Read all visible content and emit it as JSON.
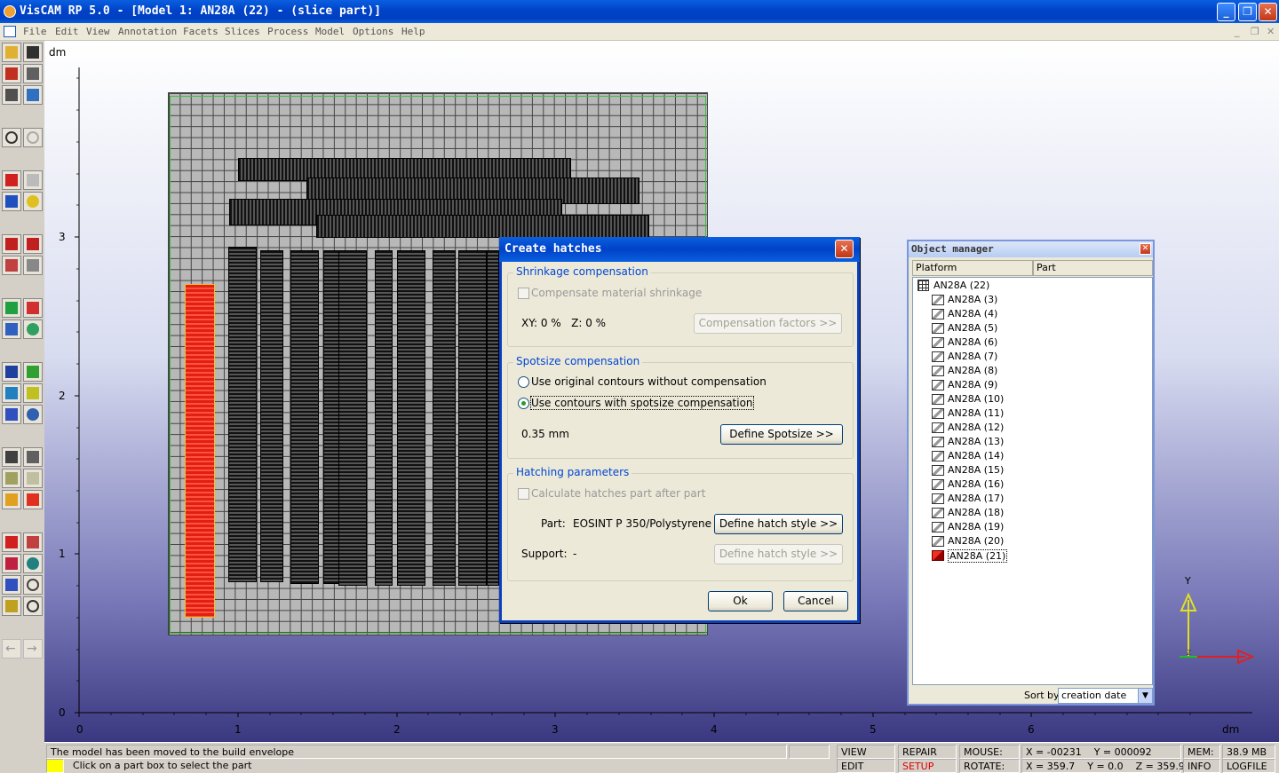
{
  "window": {
    "title": "VisCAM RP 5.0 - [Model 1: AN28A (22) - (slice part)]",
    "controls": [
      "minimize-icon",
      "restore-icon",
      "close-icon"
    ]
  },
  "menu": [
    "File",
    "Edit",
    "View",
    "Annotation",
    "Facets",
    "Slices",
    "Process",
    "Model",
    "Options",
    "Help"
  ],
  "viewport": {
    "y_unit": "dm",
    "x_unit": "dm",
    "y_ticks": [
      "3",
      "2",
      "1",
      "0"
    ],
    "x_ticks": [
      "0",
      "1",
      "2",
      "3",
      "4",
      "5",
      "6"
    ],
    "axis_y": "Y",
    "axis_z": "Z"
  },
  "dialog": {
    "title": "Create hatches",
    "shrinkage": {
      "legend": "Shrinkage compensation",
      "checkbox": "Compensate material shrinkage",
      "values": "XY: 0 %   Z: 0 %",
      "button": "Compensation factors  >>"
    },
    "spotsize": {
      "legend": "Spotsize compensation",
      "option1": "Use original contours without compensation",
      "option2": "Use contours with spotsize compensation",
      "value": "0.35 mm",
      "button": "Define Spotsize >>"
    },
    "hatching": {
      "legend": "Hatching parameters",
      "checkbox": "Calculate hatches part after part",
      "part_label": "Part:",
      "part_value": "EOSINT P 350/Polystyrene",
      "part_button": "Define hatch style >>",
      "support_label": "Support:",
      "support_value": "-",
      "support_button": "Define hatch style >>"
    },
    "ok": "Ok",
    "cancel": "Cancel"
  },
  "object_manager": {
    "title": "Object manager",
    "col_platform": "Platform",
    "col_part": "Part",
    "root": "AN28A (22)",
    "items": [
      "AN28A (3)",
      "AN28A (4)",
      "AN28A (5)",
      "AN28A (6)",
      "AN28A (7)",
      "AN28A (8)",
      "AN28A (9)",
      "AN28A (10)",
      "AN28A (11)",
      "AN28A (12)",
      "AN28A (13)",
      "AN28A (14)",
      "AN28A (15)",
      "AN28A (16)",
      "AN28A (17)",
      "AN28A (18)",
      "AN28A (19)",
      "AN28A (20)",
      "AN28A (21)"
    ],
    "sort_label": "Sort by",
    "sort_value": "creation date"
  },
  "status": {
    "message1": "The model has been moved to the build envelope",
    "message2": "Click on a part box to select the part",
    "view": "VIEW",
    "edit": "EDIT",
    "repair": "REPAIR",
    "setup": "SETUP",
    "mouse_label": "MOUSE:",
    "mouse_value": "X = -00231    Y = 000092",
    "rotate_label": "ROTATE:",
    "rotate_value": "X = 359.7    Y = 0.0    Z = 359.9",
    "mem_label": "MEM:",
    "mem_value": "38.9 MB",
    "info": "INFO",
    "logfile": "LOGFILE",
    "setup_color": "#e00000"
  }
}
